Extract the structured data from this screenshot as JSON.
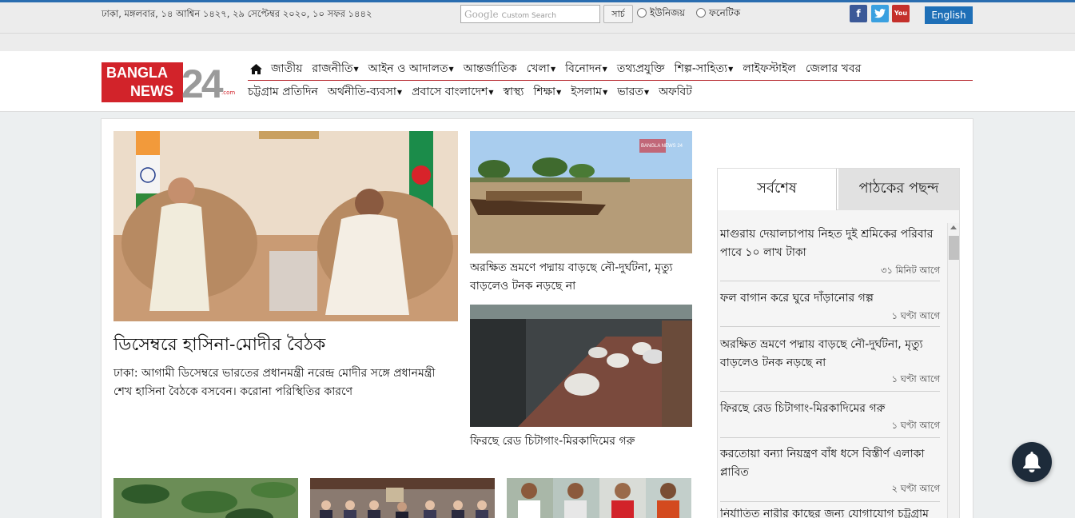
{
  "topbar": {
    "date": "ঢাকা, মঙ্গলবার, ১৪ আশ্বিন ১৪২৭, ২৯ সেপ্টেম্বর ২০২০, ১০ সফর ১৪৪২",
    "search_brand": "Google",
    "search_placeholder": "Custom Search",
    "search_button": "সার্চ",
    "radio_unijoy": "ইউনিজয়",
    "radio_phonetic": "ফনেটিক",
    "social": {
      "facebook": "f",
      "twitter": "t",
      "youtube": "You"
    },
    "english": "English"
  },
  "logo": {
    "line1": "BANGLA",
    "line2": "NEWS",
    "number": "24",
    "domain": ".com"
  },
  "nav": {
    "row1": [
      {
        "label": "জাতীয়",
        "caret": false
      },
      {
        "label": "রাজনীতি",
        "caret": true
      },
      {
        "label": "আইন ও আদালত",
        "caret": true
      },
      {
        "label": "আন্তর্জাতিক",
        "caret": false
      },
      {
        "label": "খেলা",
        "caret": true
      },
      {
        "label": "বিনোদন",
        "caret": true
      },
      {
        "label": "তথ্যপ্রযুক্তি",
        "caret": false
      },
      {
        "label": "শিল্প-সাহিত্য",
        "caret": true
      },
      {
        "label": "লাইফস্টাইল",
        "caret": false
      },
      {
        "label": "জেলার খবর",
        "caret": false
      }
    ],
    "row2": [
      {
        "label": "চট্টগ্রাম প্রতিদিন",
        "caret": false
      },
      {
        "label": "অর্থনীতি-ব্যবসা",
        "caret": true
      },
      {
        "label": "প্রবাসে বাংলাদেশ",
        "caret": true
      },
      {
        "label": "স্বাস্থ্য",
        "caret": false
      },
      {
        "label": "শিক্ষা",
        "caret": true
      },
      {
        "label": "ইসলাম",
        "caret": true
      },
      {
        "label": "ভারত",
        "caret": true
      },
      {
        "label": "অফবিট",
        "caret": false
      }
    ]
  },
  "lead": {
    "title": "ডিসেম্বরে হাসিনা-মোদীর বৈঠক",
    "summary": "ঢাকা: আগামী ডিসেম্বরে ভারতের প্রধানমন্ত্রী নরেন্দ্র মোদীর সঙ্গে প্রধানমন্ত্রী শেখ হাসিনা বৈঠকে বসবেন। করোনা পরিস্থিতির কারণে"
  },
  "stories": [
    {
      "title": "অরক্ষিত ভ্রমণে পদ্মায় বাড়ছে নৌ-দুর্ঘটনা, মৃত্যু বাড়লেও টনক নড়ছে না",
      "watermark": "BANGLA NEWS 24"
    },
    {
      "title": "ফিরছে রেড চিটাগাং-মিরকাদিমের গরু",
      "watermark": "BANGLA NEWS 24"
    }
  ],
  "sidebar": {
    "tab_latest": "সর্বশেষ",
    "tab_popular": "পাঠকের পছন্দ",
    "items": [
      {
        "title": "মাগুরায় দেয়ালচাপায় নিহত দুই শ্রমিকের পরিবার পাবে ১০ লাখ টাকা",
        "time": "৩১ মিনিট আগে"
      },
      {
        "title": "ফল বাগান করে ঘুরে দাঁড়ানোর গল্প",
        "time": "১ ঘণ্টা আগে"
      },
      {
        "title": "অরক্ষিত ভ্রমণে পদ্মায় বাড়ছে নৌ-দুর্ঘটনা, মৃত্যু বাড়লেও টনক নড়ছে না",
        "time": "১ ঘণ্টা আগে"
      },
      {
        "title": "ফিরছে রেড চিটাগাং-মিরকাদিমের গরু",
        "time": "১ ঘণ্টা আগে"
      },
      {
        "title": "করতোয়া বন্যা নিয়ন্ত্রণ বাঁধ ধসে বিস্তীর্ণ এলাকা প্লাবিত",
        "time": "২ ঘণ্টা আগে"
      },
      {
        "title": "নির্যাতিত নারীর কাছের জন্য যোগাযোগ চট্টগ্রাম হেতে",
        "time": ""
      }
    ]
  },
  "colors": {
    "brand_red": "#d2232a",
    "link_blue": "#1e6fb7",
    "bell_bg": "#1d2b3a"
  }
}
